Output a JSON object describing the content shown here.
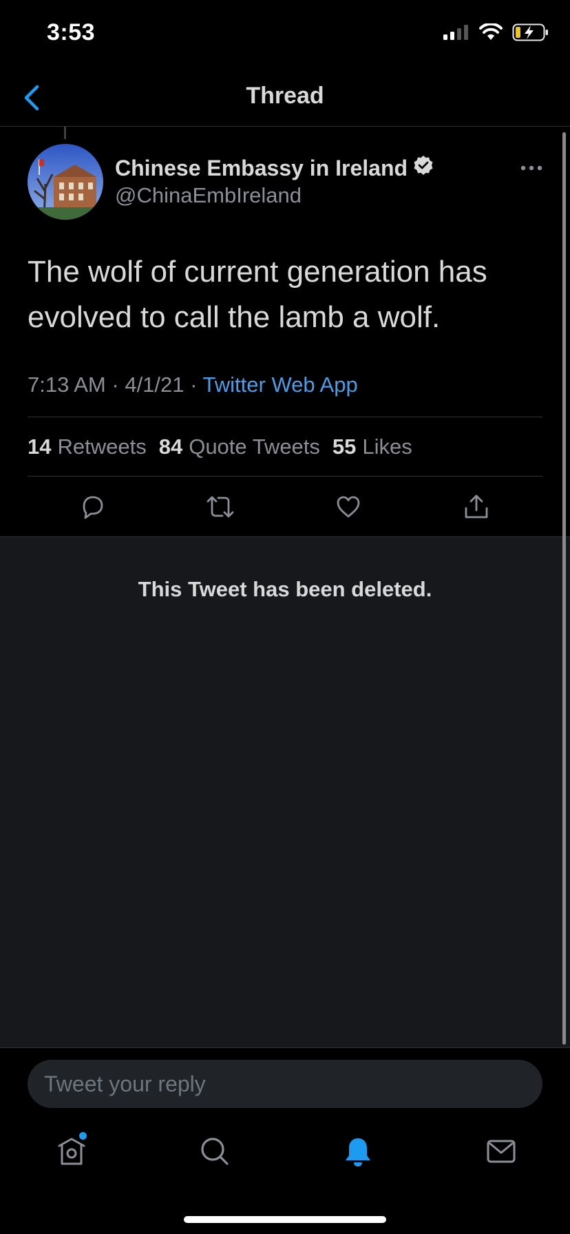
{
  "status_bar": {
    "time": "3:53",
    "signal_icon": "cellular-signal-icon",
    "wifi_icon": "wifi-icon",
    "battery_icon": "battery-charging-icon"
  },
  "header": {
    "title": "Thread",
    "back_icon": "chevron-left-icon"
  },
  "tweet": {
    "author_name": "Chinese Embassy in Ireland",
    "author_handle": "@ChinaEmbIreland",
    "verified_icon": "verified-badge-icon",
    "text": "The wolf of current generation has evolved to call the lamb a wolf.",
    "time": "7:13 AM",
    "date": "4/1/21",
    "separator": "·",
    "source": "Twitter Web App",
    "stats": {
      "retweets_count": "14",
      "retweets_label": "Retweets",
      "quotes_count": "84",
      "quotes_label": "Quote Tweets",
      "likes_count": "55",
      "likes_label": "Likes"
    },
    "actions": [
      "reply-icon",
      "retweet-icon",
      "like-icon",
      "share-icon"
    ]
  },
  "deleted_notice": "This Tweet has been deleted.",
  "reply_box": {
    "placeholder": "Tweet your reply"
  },
  "tab_bar": {
    "tabs": [
      "home-icon",
      "search-icon",
      "notifications-icon",
      "messages-icon"
    ],
    "active": "notifications-icon"
  },
  "colors": {
    "accent": "#1d9bf0",
    "link": "#4a9ee7",
    "background": "#000000",
    "panel": "#16181c",
    "muted_text": "#8b9096"
  }
}
